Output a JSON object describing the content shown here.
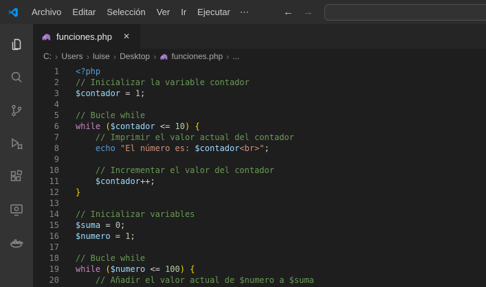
{
  "titlebar": {
    "menus": [
      "Archivo",
      "Editar",
      "Selección",
      "Ver",
      "Ir",
      "Ejecutar",
      "⋯"
    ],
    "back_icon": "←",
    "forward_icon": "→",
    "search": {
      "value": "",
      "placeholder": ""
    }
  },
  "activity_bar": {
    "items": [
      "explorer",
      "search",
      "source-control",
      "run-debug",
      "extensions",
      "remote-preview",
      "docker"
    ]
  },
  "tabbar": {
    "tab": {
      "label": "funciones.php",
      "close_icon": "✕"
    }
  },
  "breadcrumb": {
    "separator": "›",
    "items": [
      "C:",
      "Users",
      "luise",
      "Desktop",
      "funciones.php",
      "..."
    ]
  },
  "editor": {
    "colors": {
      "comment": "#6a9955",
      "keyword": "#c586c0",
      "variable": "#9cdcfe",
      "number": "#b5cea8",
      "string": "#ce9178",
      "tag": "#569cd6",
      "bracket": "#ffd700",
      "default": "#d4d4d4",
      "line_number": "#858585",
      "background": "#1e1e1e",
      "php_icon": "#a074c4",
      "logo_blue": "#0098ff"
    },
    "lines": [
      {
        "n": 1,
        "t": [
          [
            "tag",
            "<?php"
          ]
        ]
      },
      {
        "n": 2,
        "t": [
          [
            "comment",
            "// Inicializar la variable contador"
          ]
        ]
      },
      {
        "n": 3,
        "t": [
          [
            "variable",
            "$contador"
          ],
          [
            "default",
            " = "
          ],
          [
            "number",
            "1"
          ],
          [
            "default",
            ";"
          ]
        ]
      },
      {
        "n": 4,
        "t": []
      },
      {
        "n": 5,
        "t": [
          [
            "comment",
            "// Bucle while"
          ]
        ]
      },
      {
        "n": 6,
        "t": [
          [
            "keyword",
            "while"
          ],
          [
            "default",
            " "
          ],
          [
            "bracket",
            "("
          ],
          [
            "variable",
            "$contador"
          ],
          [
            "default",
            " <= "
          ],
          [
            "number",
            "10"
          ],
          [
            "bracket",
            ")"
          ],
          [
            "default",
            " "
          ],
          [
            "bracket",
            "{"
          ]
        ]
      },
      {
        "n": 7,
        "t": [
          [
            "comment",
            "    // Imprimir el valor actual del contador"
          ]
        ]
      },
      {
        "n": 8,
        "t": [
          [
            "default",
            "    "
          ],
          [
            "tag",
            "echo"
          ],
          [
            "default",
            " "
          ],
          [
            "string",
            "\"El número es: "
          ],
          [
            "variable",
            "$contador"
          ],
          [
            "string",
            "<br>\""
          ],
          [
            "default",
            ";"
          ]
        ]
      },
      {
        "n": 9,
        "t": []
      },
      {
        "n": 10,
        "t": [
          [
            "comment",
            "    // Incrementar el valor del contador"
          ]
        ]
      },
      {
        "n": 11,
        "t": [
          [
            "default",
            "    "
          ],
          [
            "variable",
            "$contador"
          ],
          [
            "default",
            "++;"
          ]
        ]
      },
      {
        "n": 12,
        "t": [
          [
            "bracket",
            "}"
          ]
        ]
      },
      {
        "n": 13,
        "t": []
      },
      {
        "n": 14,
        "t": [
          [
            "comment",
            "// Inicializar variables"
          ]
        ]
      },
      {
        "n": 15,
        "t": [
          [
            "variable",
            "$suma"
          ],
          [
            "default",
            " = "
          ],
          [
            "number",
            "0"
          ],
          [
            "default",
            ";"
          ]
        ]
      },
      {
        "n": 16,
        "t": [
          [
            "variable",
            "$numero"
          ],
          [
            "default",
            " = "
          ],
          [
            "number",
            "1"
          ],
          [
            "default",
            ";"
          ]
        ]
      },
      {
        "n": 17,
        "t": []
      },
      {
        "n": 18,
        "t": [
          [
            "comment",
            "// Bucle while"
          ]
        ]
      },
      {
        "n": 19,
        "t": [
          [
            "keyword",
            "while"
          ],
          [
            "default",
            " "
          ],
          [
            "bracket",
            "("
          ],
          [
            "variable",
            "$numero"
          ],
          [
            "default",
            " <= "
          ],
          [
            "number",
            "100"
          ],
          [
            "bracket",
            ")"
          ],
          [
            "default",
            " "
          ],
          [
            "bracket",
            "{"
          ]
        ]
      },
      {
        "n": 20,
        "t": [
          [
            "comment",
            "    // Añadir el valor actual de $numero a $suma"
          ]
        ]
      }
    ]
  }
}
